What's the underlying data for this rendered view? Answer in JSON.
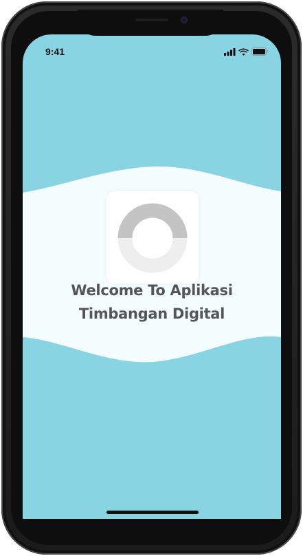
{
  "status_bar": {
    "time": "9:41",
    "icons": [
      "cellular-signal-icon",
      "wifi-icon",
      "battery-icon"
    ]
  },
  "splash": {
    "title_line1": "Welcome To Aplikasi",
    "title_line2": "Timbangan Digital",
    "loader": "loading-spinner"
  },
  "colors": {
    "background": "#88d4e3",
    "wave_band": "#f4fdff",
    "title_text": "#555555",
    "spinner_track": "#eeeeee",
    "spinner_arc": "#c4c4c4"
  }
}
